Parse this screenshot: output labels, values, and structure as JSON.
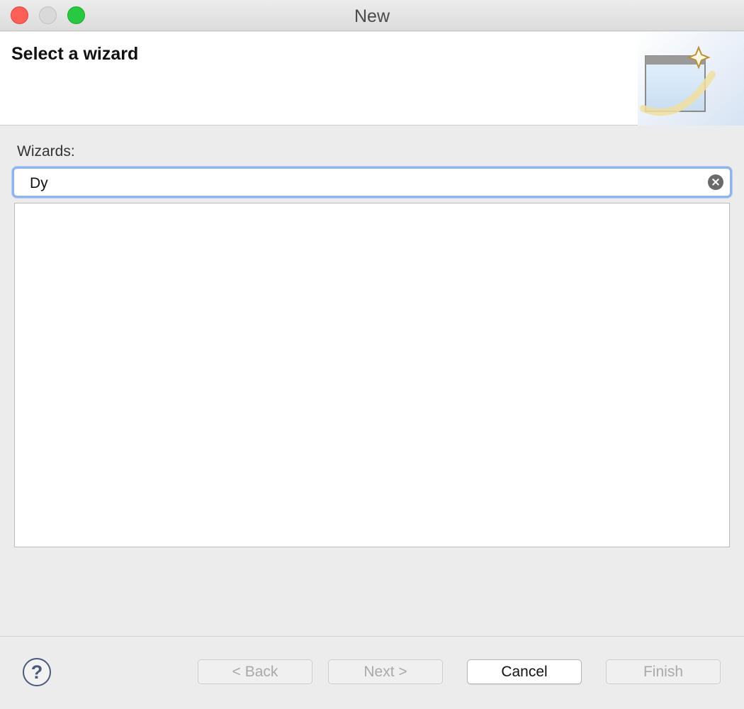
{
  "window": {
    "title": "New"
  },
  "header": {
    "title": "Select a wizard",
    "banner_icon": "new-wizard-banner-icon"
  },
  "filter": {
    "label": "Wizards:",
    "value": "Dy",
    "clear_icon": "clear-icon"
  },
  "wizard_list": {
    "items": []
  },
  "footer": {
    "help_icon": "help-icon",
    "buttons": {
      "back": "< Back",
      "next": "Next >",
      "cancel": "Cancel",
      "finish": "Finish"
    }
  },
  "colors": {
    "focus_ring": "#8fb3ee",
    "close": "#fe5f57",
    "zoom": "#28c840"
  }
}
